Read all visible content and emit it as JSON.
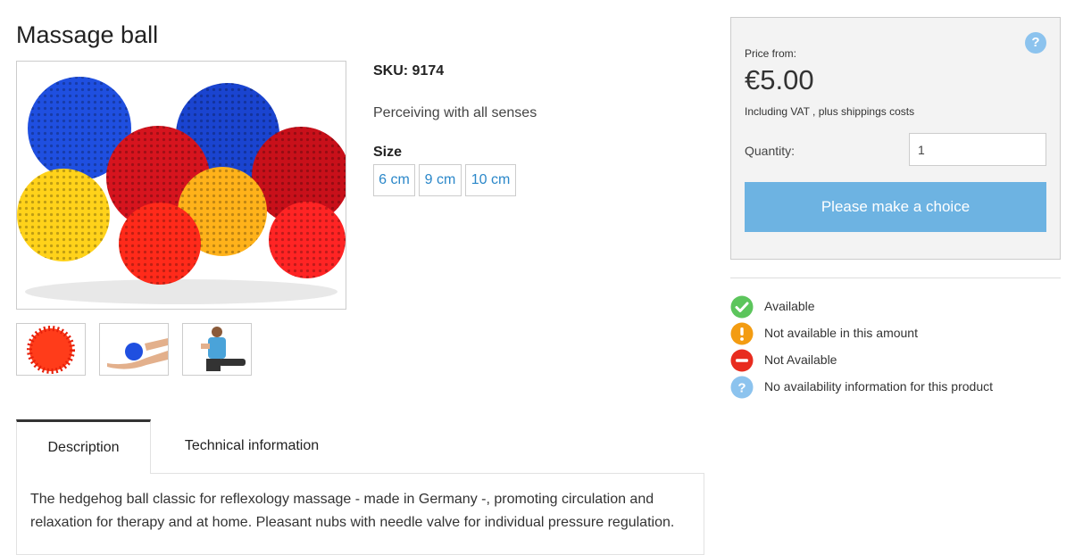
{
  "product": {
    "title": "Massage ball",
    "sku": "SKU: 9174",
    "tagline": "Perceiving with all senses",
    "size_label": "Size",
    "sizes": [
      "6 cm",
      "9 cm",
      "10 cm"
    ]
  },
  "tabs": {
    "description": "Description",
    "technical": "Technical information"
  },
  "description": {
    "text": "The hedgehog ball classic for reflexology massage - made in Germany -, promoting circulation and relaxation for therapy and at home. Pleasant nubs with needle valve for individual pressure regulation."
  },
  "buy_box": {
    "help_label": "?",
    "price_from_label": "Price from:",
    "price": "€5.00",
    "vat_note": "Including VAT , plus shippings costs",
    "quantity_label": "Quantity:",
    "quantity_value": "1",
    "choice_button": "Please make a choice"
  },
  "availability_legend": [
    {
      "label": "Available",
      "icon": "check-icon",
      "color": "#5cc55c"
    },
    {
      "label": "Not available in this amount",
      "icon": "exclamation-icon",
      "color": "#f39c12"
    },
    {
      "label": "Not Available",
      "icon": "minus-icon",
      "color": "#e82c1f"
    },
    {
      "label": "No availability information for this product",
      "icon": "question-icon",
      "color": "#8cc3ee"
    }
  ],
  "colors": {
    "accent": "#6db3e2",
    "link": "#2a87c9",
    "help": "#8cc3ee"
  }
}
